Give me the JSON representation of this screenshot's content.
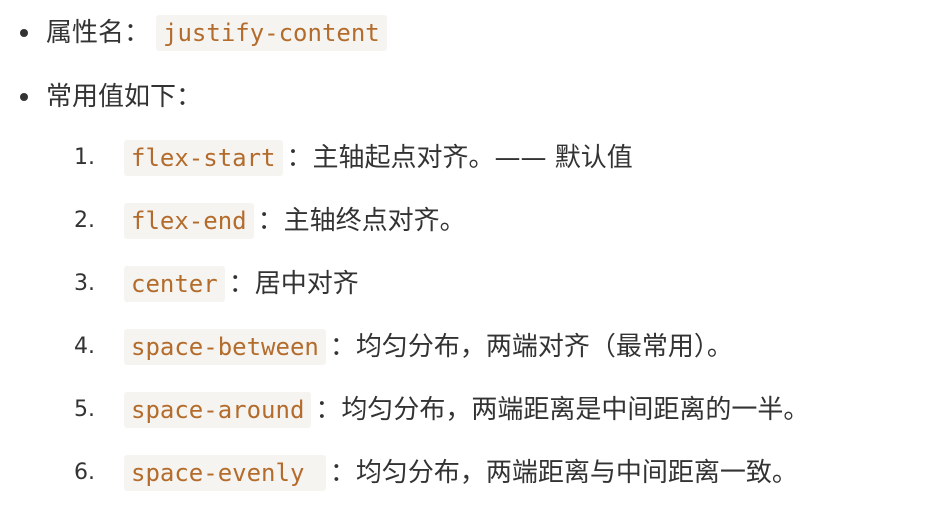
{
  "doc": {
    "property": {
      "label": "属性名：",
      "code": "justify-content"
    },
    "values_heading": "常用值如下：",
    "items": [
      {
        "num": "1.",
        "code": "flex-start",
        "desc": "：主轴起点对齐。—— 默认值"
      },
      {
        "num": "2.",
        "code": "flex-end",
        "desc": "：主轴终点对齐。"
      },
      {
        "num": "3.",
        "code": "center",
        "desc": "：居中对齐"
      },
      {
        "num": "4.",
        "code": "space-between",
        "desc": "：均匀分布，两端对齐（最常用）。"
      },
      {
        "num": "5.",
        "code": "space-around",
        "desc": "：均匀分布，两端距离是中间距离的一半。"
      },
      {
        "num": "6.",
        "code": "space-evenly ",
        "desc": "：均匀分布，两端距离与中间距离一致。"
      }
    ]
  }
}
